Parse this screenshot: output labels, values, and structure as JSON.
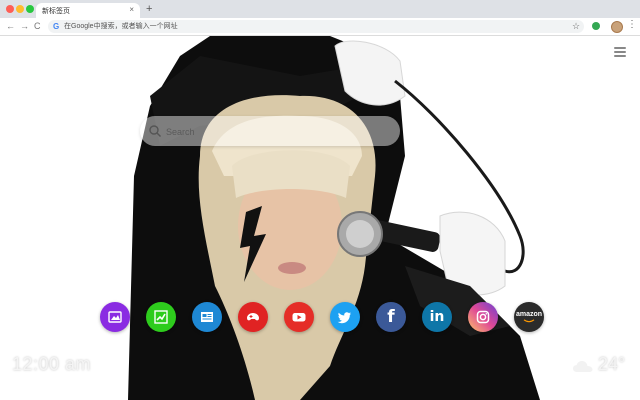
{
  "browser": {
    "tab_title": "新标签页",
    "tab_close": "×",
    "new_tab": "+",
    "nav_back": "←",
    "nav_forward": "→",
    "nav_reload": "C",
    "omnibox_placeholder": "在Google中搜索，或者输入一个网址",
    "google_badge": "G",
    "bookmark_star": "☆",
    "menu_glyph": "⋮"
  },
  "page": {
    "search_placeholder": "Search",
    "clock": "12:00 am",
    "temperature": "24°",
    "weather_icon": "cloud-icon",
    "menu_icon": "hamburger-menu-icon"
  },
  "shortcuts": [
    {
      "name": "image-app",
      "color": "#8a2be2",
      "icon": "image-icon"
    },
    {
      "name": "chart-app",
      "color": "#2ecc1d",
      "icon": "chart-icon"
    },
    {
      "name": "news-app",
      "color": "#1e88d4",
      "icon": "newspaper-icon"
    },
    {
      "name": "game-app",
      "color": "#e02323",
      "icon": "gamepad-icon"
    },
    {
      "name": "youtube",
      "color": "#e52d27",
      "icon": "youtube-icon"
    },
    {
      "name": "twitter",
      "color": "#1da1f2",
      "icon": "twitter-icon"
    },
    {
      "name": "facebook",
      "color": "#3b5998",
      "icon": "facebook-icon",
      "glyph": "f"
    },
    {
      "name": "linkedin",
      "color": "#0e76a8",
      "icon": "linkedin-icon",
      "glyph": "in"
    },
    {
      "name": "instagram",
      "color": "#d6249f",
      "icon": "instagram-icon"
    },
    {
      "name": "amazon",
      "color": "#2b2b2b",
      "icon": "amazon-icon",
      "glyph": "amazon"
    }
  ]
}
